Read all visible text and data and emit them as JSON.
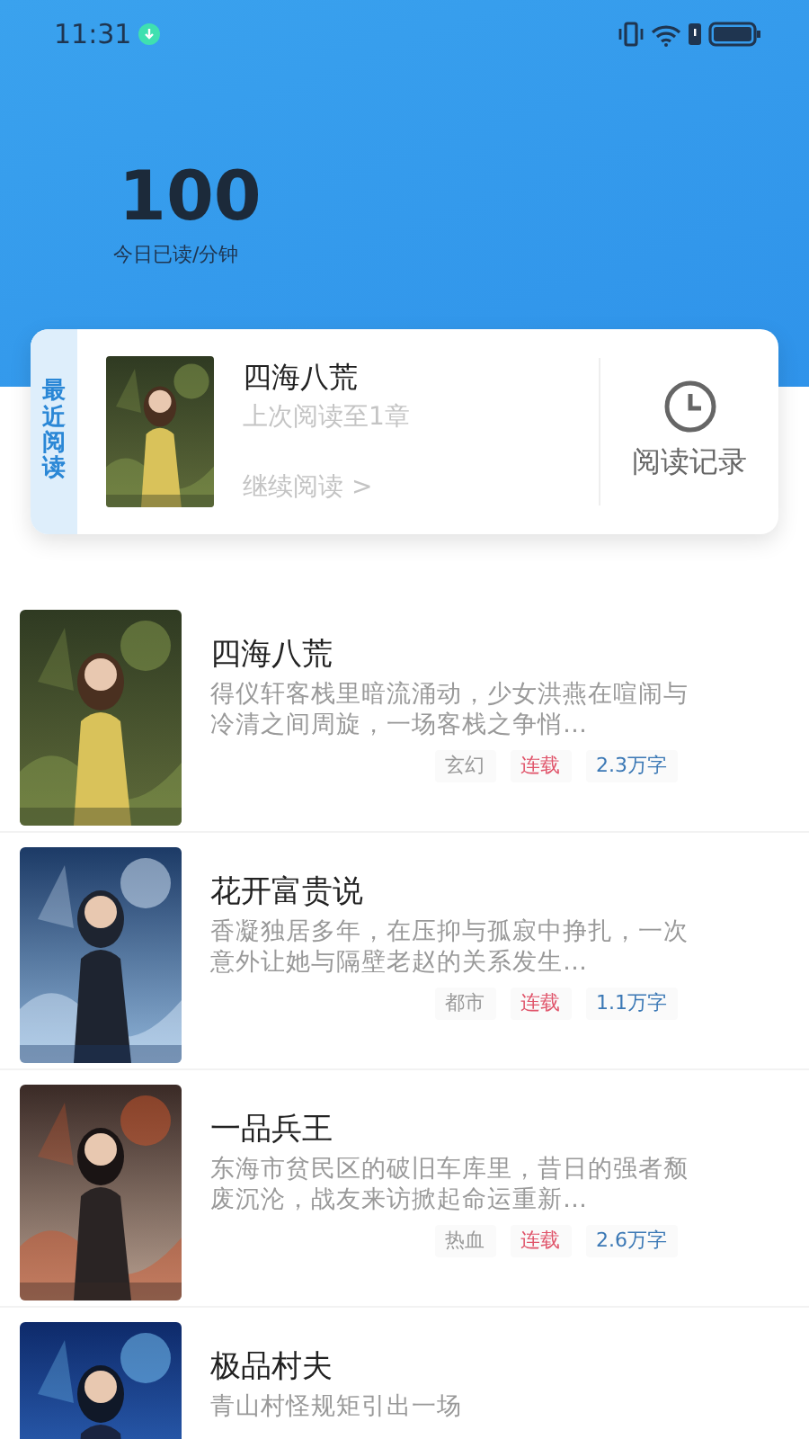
{
  "status_bar": {
    "time": "11:31"
  },
  "stats": {
    "value": "100",
    "label": "今日已读/分钟"
  },
  "recent": {
    "tab_label": "最近阅读",
    "title": "四海八荒",
    "progress": "上次阅读至1章",
    "continue": "继续阅读 >",
    "history_label": "阅读记录"
  },
  "books": [
    {
      "title": "四海八荒",
      "description": "得仪轩客栈里暗流涌动，少女洪燕在喧闹与冷清之间周旋，一场客栈之争悄…",
      "tags": [
        {
          "text": "玄幻",
          "kind": "genre"
        },
        {
          "text": "连载",
          "kind": "status"
        },
        {
          "text": "2.3万字",
          "kind": "words"
        }
      ]
    },
    {
      "title": "花开富贵说",
      "description": "香凝独居多年，在压抑与孤寂中挣扎，一次意外让她与隔壁老赵的关系发生…",
      "tags": [
        {
          "text": "都市",
          "kind": "genre"
        },
        {
          "text": "连载",
          "kind": "status"
        },
        {
          "text": "1.1万字",
          "kind": "words"
        }
      ]
    },
    {
      "title": "一品兵王",
      "description": "东海市贫民区的破旧车库里，昔日的强者颓废沉沦，战友来访掀起命运重新…",
      "tags": [
        {
          "text": "热血",
          "kind": "genre"
        },
        {
          "text": "连载",
          "kind": "status"
        },
        {
          "text": "2.6万字",
          "kind": "words"
        }
      ]
    },
    {
      "title": "极品村夫",
      "description": "青山村怪规矩引出一场"
    }
  ]
}
